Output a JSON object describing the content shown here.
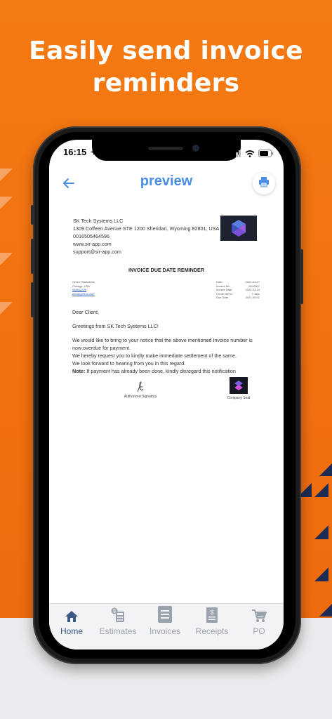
{
  "headline": {
    "line1": "Easily send invoice",
    "line2": "reminders"
  },
  "status_bar": {
    "time": "16:15"
  },
  "nav": {
    "title": "preview",
    "back_icon": "back-arrow-icon",
    "print_icon": "printer-icon"
  },
  "document": {
    "company": {
      "name": "SK Tech Systems LLC",
      "address": "1309 Coffeen Avenue STE 1200 Sheridan, Wyoming 82801, USA",
      "phone": "0016505464596",
      "website": "www.sir-app.com",
      "email": "support@sir-app.com"
    },
    "title": "INVOICE DUE DATE REMINDER",
    "client": {
      "name": "Green Plantations",
      "location": "Chicago, USA",
      "phone": "088542225",
      "email": "info@greeno.com"
    },
    "meta": [
      {
        "label": "Date:",
        "value": "2021-04-27"
      },
      {
        "label": "Invoice No:",
        "value": "INV0007"
      },
      {
        "label": "Invoice Date:",
        "value": "2021-04-24"
      },
      {
        "label": "Credit Terms:",
        "value": "7 days"
      },
      {
        "label": "Due Date:",
        "value": "2021-05-01"
      }
    ],
    "salutation": "Dear Client,",
    "greeting": "Greetings from SK Tech Systems LLC!",
    "paragraph1": "We would like to bring to your notice that the above mentioned Invoice number is now overdue for payment.",
    "paragraph2": "We hereby request you to kindly make immediate settlement of the same.",
    "paragraph3": "We look forward to hearing from you in this regard.",
    "note_label": "Note:",
    "note_text": " If payment has already been done, kindly disregard this notification",
    "signature_label": "Authorized Signatory",
    "seal_label": "Company Seal"
  },
  "tabbar": {
    "items": [
      {
        "label": "Home",
        "icon": "home-icon",
        "active": true
      },
      {
        "label": "Estimates",
        "icon": "calculator-icon",
        "active": false
      },
      {
        "label": "Invoices",
        "icon": "invoice-icon",
        "active": false
      },
      {
        "label": "Receipts",
        "icon": "receipt-icon",
        "active": false
      },
      {
        "label": "PO",
        "icon": "cart-icon",
        "active": false
      }
    ]
  },
  "colors": {
    "accent": "#4a8ee6",
    "background": "#f47a12",
    "tab_active": "#3b5a86",
    "tab_inactive": "#9aa3ad"
  }
}
